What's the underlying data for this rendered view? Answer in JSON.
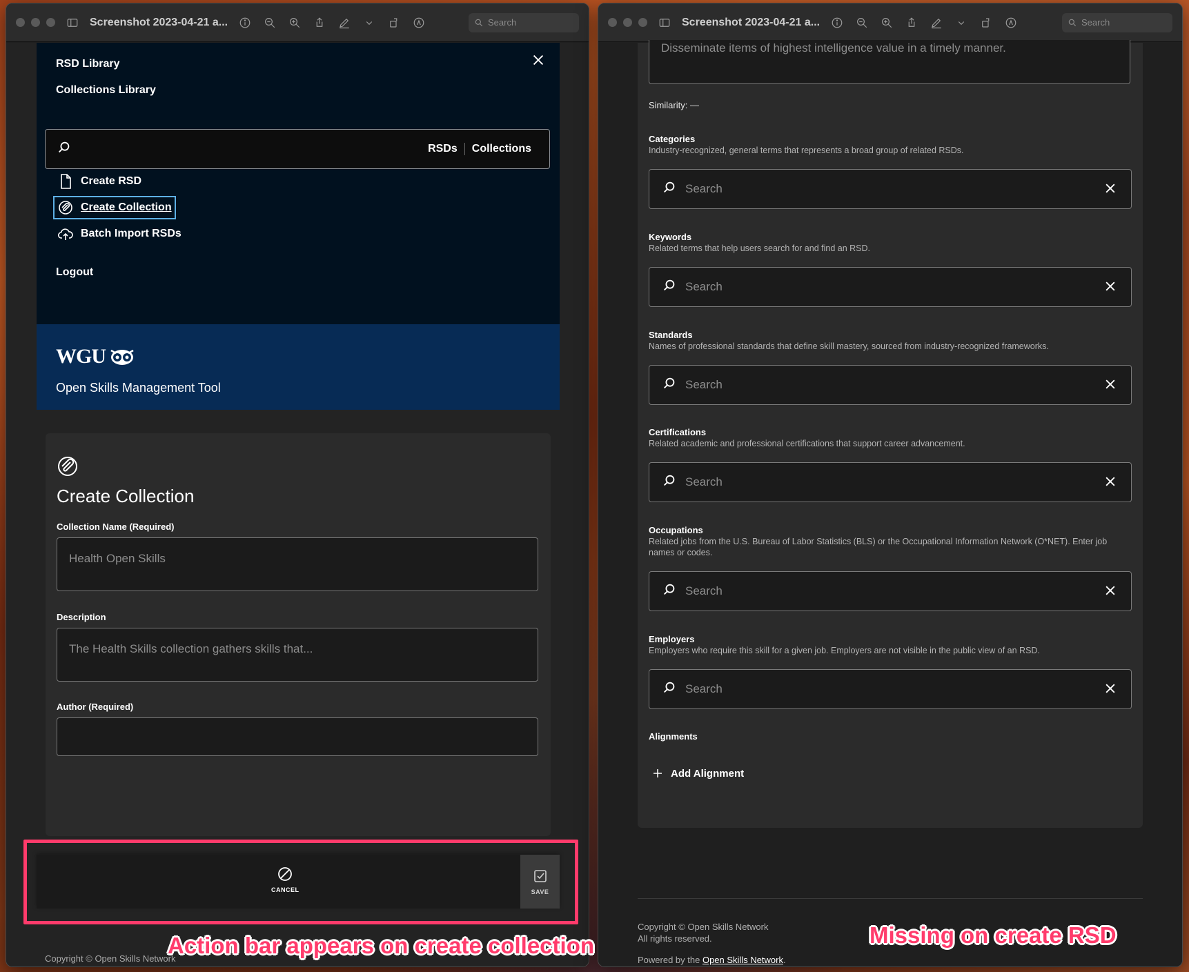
{
  "left_window": {
    "title": "Screenshot 2023-04-21 a...",
    "search_placeholder": "Search",
    "menu": {
      "rsd_library": "RSD Library",
      "collections_library": "Collections Library",
      "search_tabs": [
        "RSDs",
        "Collections"
      ],
      "create_rsd": "Create RSD",
      "create_collection": "Create Collection",
      "batch_import": "Batch Import RSDs",
      "logout": "Logout"
    },
    "brand": {
      "logo_text": "WGU",
      "subtitle": "Open Skills Management Tool"
    },
    "form": {
      "title": "Create Collection",
      "name_label": "Collection Name (Required)",
      "name_placeholder": "Health Open Skills",
      "description_label": "Description",
      "description_placeholder": "The Health Skills collection gathers skills that...",
      "author_label": "Author (Required)"
    },
    "action_bar": {
      "cancel": "CANCEL",
      "save": "SAVE"
    },
    "copyright": "Copyright © Open Skills Network"
  },
  "right_window": {
    "title": "Screenshot 2023-04-21 a...",
    "search_placeholder": "Search",
    "top_text": "Disseminate items of highest intelligence value in a timely manner.",
    "similarity": "Similarity: —",
    "sections": [
      {
        "title": "Categories",
        "desc": "Industry-recognized, general terms that represents a broad group of related RSDs.",
        "placeholder": "Search"
      },
      {
        "title": "Keywords",
        "desc": "Related terms that help users search for and find an RSD.",
        "placeholder": "Search"
      },
      {
        "title": "Standards",
        "desc": "Names of professional standards that define skill mastery, sourced from industry-recognized frameworks.",
        "placeholder": "Search"
      },
      {
        "title": "Certifications",
        "desc": "Related academic and professional certifications that support career advancement.",
        "placeholder": "Search"
      },
      {
        "title": "Occupations",
        "desc": "Related jobs from the U.S. Bureau of Labor Statistics (BLS) or the Occupational Information Network (O*NET). Enter job names or codes.",
        "placeholder": "Search"
      },
      {
        "title": "Employers",
        "desc": "Employers who require this skill for a given job. Employers are not visible in the public view of an RSD.",
        "placeholder": "Search"
      }
    ],
    "alignments_title": "Alignments",
    "add_alignment": "Add Alignment",
    "footer": {
      "copyright": "Copyright © Open Skills Network",
      "rights": "All rights reserved.",
      "powered_prefix": "Powered by the ",
      "powered_link": "Open Skills Network",
      "powered_suffix": "."
    }
  },
  "annotations": {
    "left": "Action bar appears on create collection",
    "right": "Missing on create RSD",
    "color": "#ff3b6b"
  }
}
